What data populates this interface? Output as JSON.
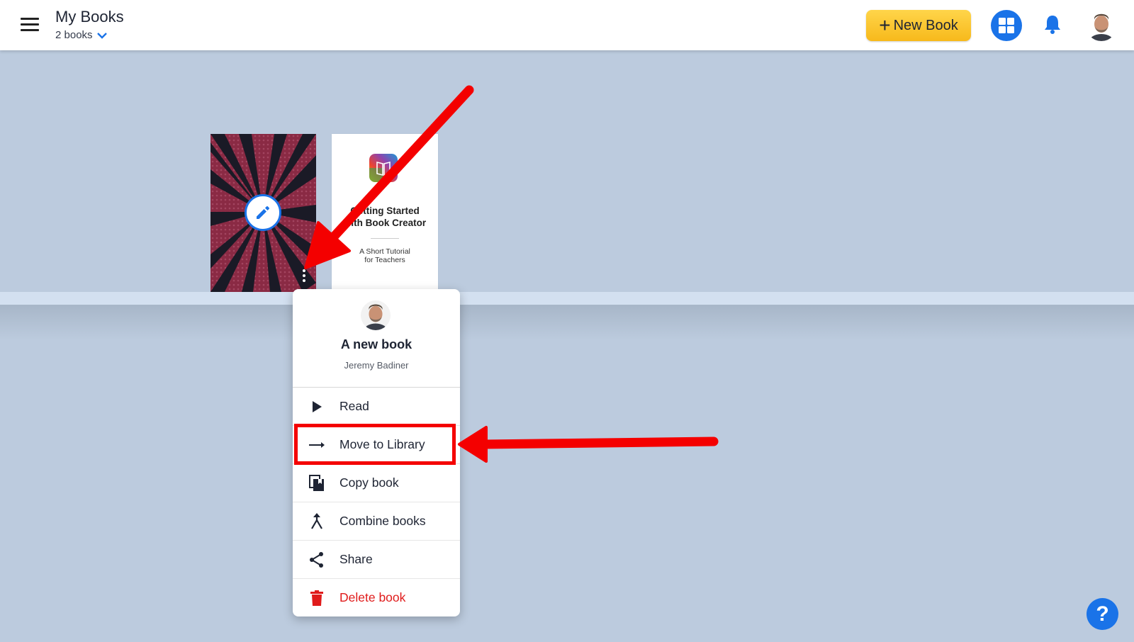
{
  "header": {
    "title": "My Books",
    "book_count": "2 books",
    "new_book_label": "New Book",
    "new_book_plus": "+"
  },
  "books": [
    {
      "name": "comic-cover-book"
    },
    {
      "title_line1": "Getting Started",
      "title_line2": "with Book Creator",
      "subtitle_line1": "A Short Tutorial",
      "subtitle_line2": "for Teachers"
    }
  ],
  "menu": {
    "book_title": "A new book",
    "author": "Jeremy Badiner",
    "items": [
      {
        "label": "Read",
        "icon": "play-icon"
      },
      {
        "label": "Move to Library",
        "icon": "arrow-right-icon"
      },
      {
        "label": "Copy book",
        "icon": "copy-icon"
      },
      {
        "label": "Combine books",
        "icon": "merge-icon"
      },
      {
        "label": "Share",
        "icon": "share-icon"
      },
      {
        "label": "Delete book",
        "icon": "trash-icon"
      }
    ]
  },
  "help_label": "?",
  "colors": {
    "accent": "#1a73e8",
    "new_book": "#f7b91b",
    "danger": "#e01b1b",
    "annotation": "#f40000",
    "background": "#bccbde"
  }
}
